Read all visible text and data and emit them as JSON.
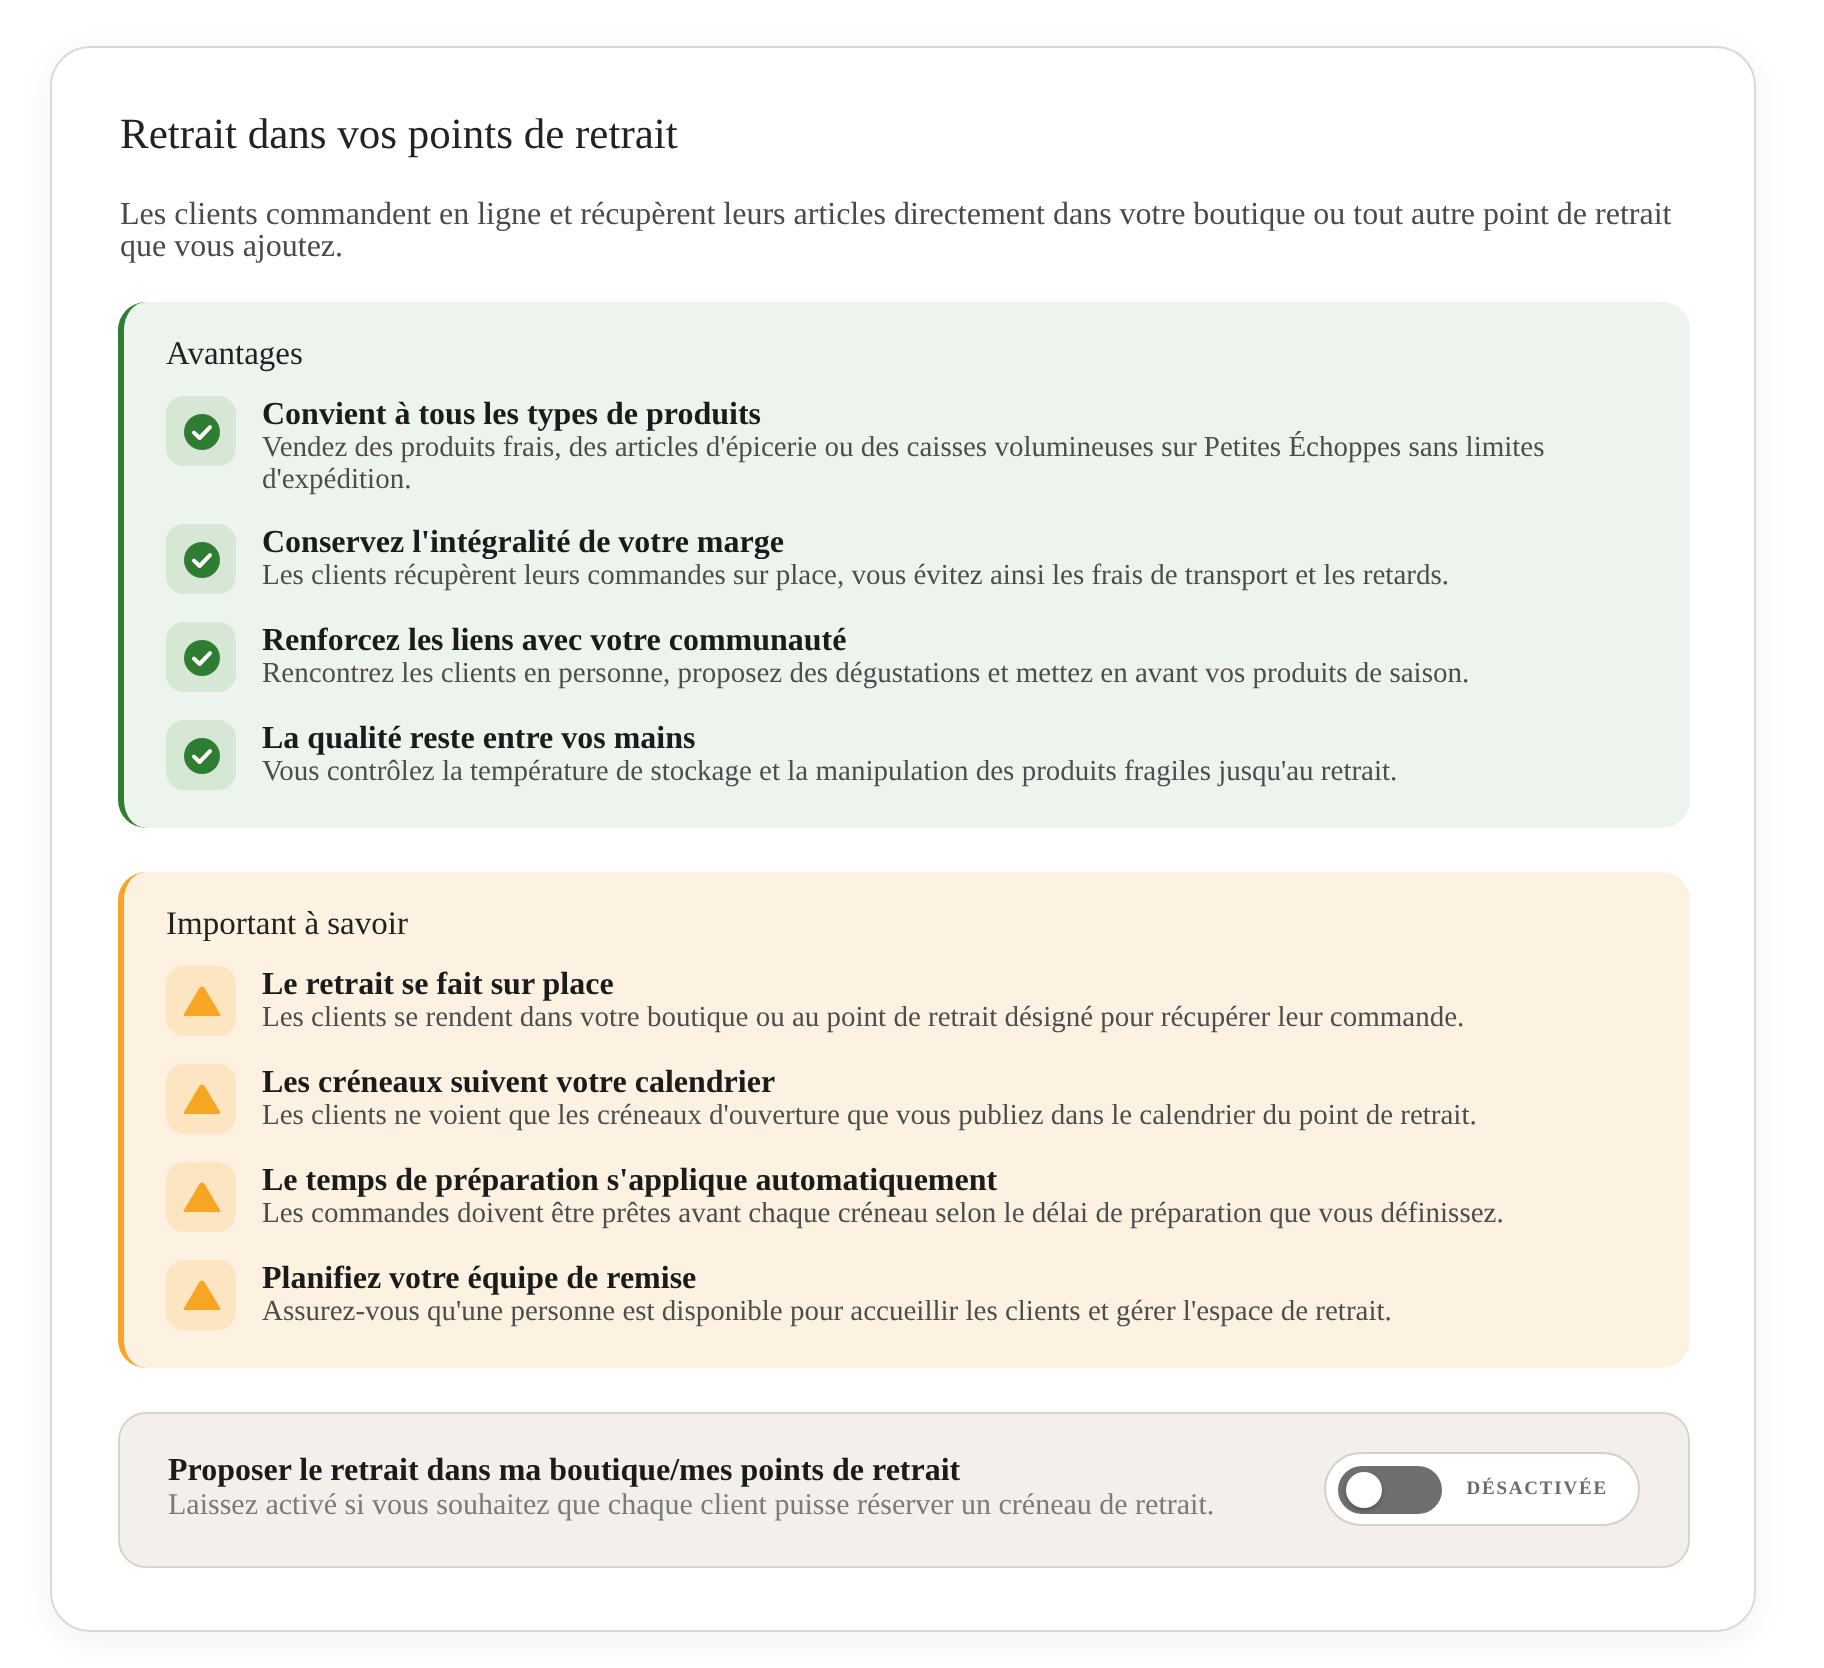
{
  "card": {
    "title": "Retrait dans vos points de retrait",
    "description": "Les clients commandent en ligne et récupèrent leurs articles directement dans votre boutique ou tout autre point de retrait que vous ajoutez."
  },
  "panels": [
    {
      "kind": "benefits",
      "heading": "Avantages",
      "items": [
        {
          "title": "Convient à tous les types de produits",
          "text": "Vendez des produits frais, des articles d'épicerie ou des caisses volumineuses sur Petites Échoppes sans limites d'expédition."
        },
        {
          "title": "Conservez l'intégralité de votre marge",
          "text": "Les clients récupèrent leurs commandes sur place, vous évitez ainsi les frais de transport et les retards."
        },
        {
          "title": "Renforcez les liens avec votre communauté",
          "text": "Rencontrez les clients en personne, proposez des dégustations et mettez en avant vos produits de saison."
        },
        {
          "title": "La qualité reste entre vos mains",
          "text": "Vous contrôlez la température de stockage et la manipulation des produits fragiles jusqu'au retrait."
        }
      ]
    },
    {
      "kind": "warnings",
      "heading": "Important à savoir",
      "items": [
        {
          "title": "Le retrait se fait sur place",
          "text": "Les clients se rendent dans votre boutique ou au point de retrait désigné pour récupérer leur commande."
        },
        {
          "title": "Les créneaux suivent votre calendrier",
          "text": "Les clients ne voient que les créneaux d'ouverture que vous publiez dans le calendrier du point de retrait."
        },
        {
          "title": "Le temps de préparation s'applique automatiquement",
          "text": "Les commandes doivent être prêtes avant chaque créneau selon le délai de préparation que vous définissez."
        },
        {
          "title": "Planifiez votre équipe de remise",
          "text": "Assurez-vous qu'une personne est disponible pour accueillir les clients et gérer l'espace de retrait."
        }
      ]
    }
  ],
  "setting": {
    "title": "Proposer le retrait dans ma boutique/mes points de retrait",
    "description": "Laissez activé si vous souhaitez que chaque client puisse réserver un créneau de retrait.",
    "toggle": {
      "on": false,
      "label": "DÉSACTIVÉE"
    }
  }
}
